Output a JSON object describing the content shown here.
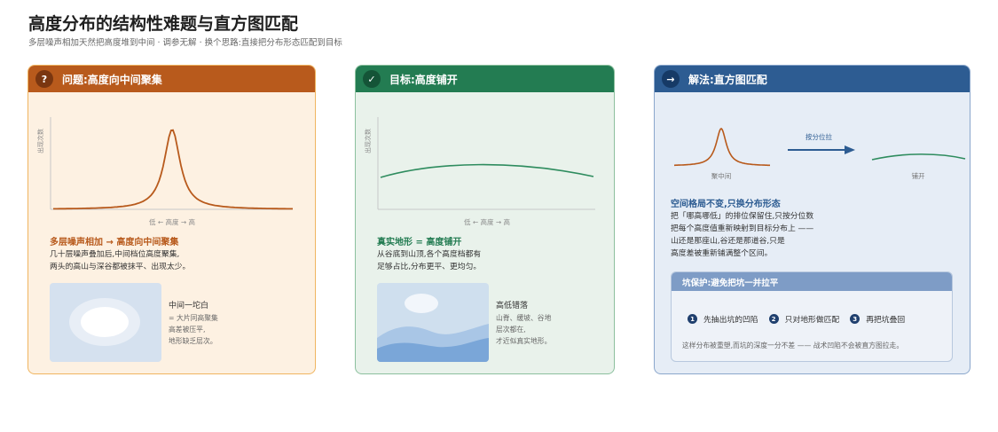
{
  "page": {
    "title": "高度分布的结构性难题与直方图匹配",
    "subtitle": "多层噪声相加天然把高度堆到中间 · 调参无解 · 换个思路:直接把分布形态匹配到目标"
  },
  "colors": {
    "problem_accent": "#b85a1c",
    "goal_accent": "#237c52",
    "solution_accent": "#2d5c92"
  },
  "cards": [
    {
      "badge": "?",
      "header": "问题:高度向中间聚集",
      "ylabel": "出现次数",
      "xlabel": "低 ← 高度 → 高",
      "heading": "多层噪声相加 → 高度向中间聚集",
      "body": [
        "几十层噪声叠加后,中间档位高度聚集,",
        "两头的高山与深谷都被抹平、出现太少。"
      ],
      "thumb_title": "中间一坨白",
      "thumb_lines": [
        "= 大片同高聚集",
        "高差被压平,",
        "地形缺乏层次。"
      ]
    },
    {
      "badge": "✓",
      "header": "目标:高度铺开",
      "ylabel": "出现次数",
      "xlabel": "低 ← 高度 → 高",
      "heading": "真实地形 = 高度铺开",
      "body": [
        "从谷底到山顶,各个高度档都有",
        "足够占比,分布更平、更均匀。"
      ],
      "thumb_title": "高低错落",
      "thumb_lines": [
        "山脊、缓坡、谷地",
        "层次都在,",
        "才近似真实地形。"
      ]
    },
    {
      "badge": "→",
      "header": "解法:直方图匹配",
      "mini_left_label": "聚中间",
      "arrow_label": "按分位拉",
      "mini_right_label": "铺开",
      "heading": "空间格局不变,只换分布形态",
      "body": [
        "把「哪高哪低」的排位保留住,只按分位数",
        "把每个高度值重新映射到目标分布上 ——",
        "山还是那座山,谷还是那道谷,只是",
        "高度差被重新铺满整个区间。"
      ],
      "pit": {
        "header": "坑保护:避免把坑一并拉平",
        "steps": [
          {
            "num": "1",
            "label": "先抽出坑的凹陷"
          },
          {
            "num": "2",
            "label": "只对地形做匹配"
          },
          {
            "num": "3",
            "label": "再把坑叠回"
          }
        ],
        "note": "这样分布被重塑,而坑的深度一分不差 —— 战术凹陷不会被直方图拉走。"
      }
    }
  ]
}
